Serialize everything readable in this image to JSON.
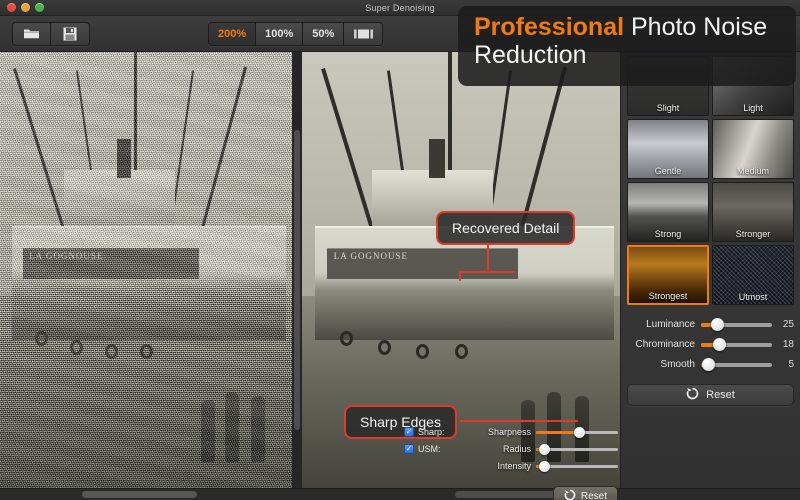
{
  "window": {
    "title": "Super Denoising",
    "traffic_lights": [
      "close-button",
      "minimize-button",
      "zoom-button"
    ]
  },
  "toolbar": {
    "open_icon": "open-folder-icon",
    "save_icon": "save-disk-icon",
    "zoom_levels": [
      {
        "label": "200%",
        "active": true
      },
      {
        "label": "100%",
        "active": false
      },
      {
        "label": "50%",
        "active": false
      }
    ],
    "fit_icon": "fit-to-window-icon",
    "accent_color": "#f07a14"
  },
  "banner": {
    "word_highlight": "Professional",
    "line1_rest": " Photo Noise",
    "line2": "Reduction",
    "highlight_color": "#f07a14"
  },
  "viewer": {
    "left_pane": {
      "name": "original-noisy-image",
      "boat_name": "LA GOGNOUSE"
    },
    "right_pane": {
      "name": "denoised-result-image",
      "boat_name": "LA GOGNOUSE"
    },
    "callouts": [
      {
        "label": "Recovered Detail",
        "color": "#e03a2a"
      },
      {
        "label": "Sharp Edges",
        "color": "#e03a2a"
      }
    ]
  },
  "sharpen_panel": {
    "sharp_checkbox": {
      "label": "Sharp:",
      "checked": true,
      "mark": "✓"
    },
    "usm_checkbox": {
      "label": "USM:",
      "checked": true,
      "mark": "✓"
    },
    "sliders": [
      {
        "label": "Sharpness",
        "percent": 52
      },
      {
        "label": "Radius",
        "percent": 10
      },
      {
        "label": "Intensity",
        "percent": 10
      }
    ],
    "reset_label": "Reset",
    "reset_icon": "refresh-icon"
  },
  "sidebar": {
    "presets": [
      {
        "label": "Slight",
        "selected": false,
        "swatch": "p-slight"
      },
      {
        "label": "Light",
        "selected": false,
        "swatch": "p-light"
      },
      {
        "label": "Gentle",
        "selected": false,
        "swatch": "p-gentle"
      },
      {
        "label": "Medium",
        "selected": false,
        "swatch": "p-medium"
      },
      {
        "label": "Strong",
        "selected": false,
        "swatch": "p-strong"
      },
      {
        "label": "Stronger",
        "selected": false,
        "swatch": "p-stronger"
      },
      {
        "label": "Strongest",
        "selected": true,
        "swatch": "p-strongest"
      },
      {
        "label": "Utmost",
        "selected": false,
        "swatch": "p-utmost"
      }
    ],
    "sliders": [
      {
        "label": "Luminance",
        "value": "25",
        "percent": 22
      },
      {
        "label": "Chrominance",
        "value": "18",
        "percent": 26
      },
      {
        "label": "Smooth",
        "value": "5",
        "percent": 10
      }
    ],
    "reset_label": "Reset",
    "reset_icon": "refresh-icon",
    "selection_color": "#f07a14"
  }
}
